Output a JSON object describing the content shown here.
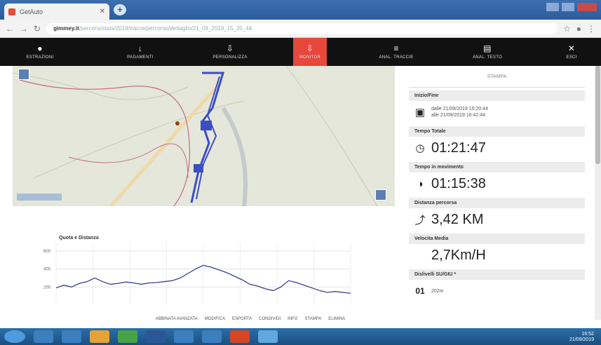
{
  "browser": {
    "tab_title": "GetAuto",
    "url_host": "gimmey.it",
    "url_rest": "/percorsi/stats/2019/tracce/percorso/dettaglio/21_09_2019_15_20_44"
  },
  "toolbar": {
    "items": [
      {
        "label": "ESTRAZIONI",
        "icon": "●"
      },
      {
        "label": "PAGAMENTI",
        "icon": "↓"
      },
      {
        "label": "PERSONALIZZA",
        "icon": "⇩"
      },
      {
        "label": "MONITOR",
        "icon": "⇩"
      },
      {
        "label": "ANAL. TRACCIE",
        "icon": "≡"
      },
      {
        "label": "ANAL. TESTO",
        "icon": "▤"
      },
      {
        "label": "ESCI",
        "icon": "✕"
      }
    ],
    "active_index": 3,
    "accent": "#e8473c"
  },
  "chart": {
    "title": "Quota e Distanza"
  },
  "chart_data": {
    "type": "line",
    "title": "Quota e Distanza",
    "ylim": [
      0,
      700
    ],
    "yticks": [
      "600",
      "400",
      "200"
    ],
    "series": [
      {
        "values": [
          190,
          220,
          200,
          240,
          260,
          300,
          260,
          230,
          240,
          255,
          245,
          230,
          245,
          250,
          260,
          270,
          300,
          350,
          400,
          440,
          420,
          390,
          360,
          320,
          280,
          230,
          210,
          180,
          160,
          200,
          270,
          250,
          220,
          190,
          160,
          140,
          150,
          140,
          130
        ]
      }
    ],
    "grid": true
  },
  "legend": [
    "ABBINATA AVANZATA",
    "MODIFICA",
    "ESPORTA",
    "CONDIVIDI",
    "INFO",
    "STAMPA",
    "ELIMINA"
  ],
  "panel": {
    "banner": "STAMPA",
    "inizio_fine_label": "Inizio/Fine",
    "dalle": "dalle 21/09/2019 15:20:44",
    "alle": "alle 21/09/2019 16:42:44",
    "tempo_totale_label": "Tempo Totale",
    "tempo_totale": "01:21:47",
    "tempo_movimento_label": "Tempo in movimento",
    "tempo_movimento": "01:15:38",
    "distanza_label": "Distanza percorsa",
    "distanza": "3,42 KM",
    "velocita_label": "Velocita Media",
    "velocita": "2,7Km/H",
    "dislivelli_label": "Dislivelli SU/GIU *",
    "dislivelli_icon": "01",
    "dislivelli_value": "202m"
  },
  "taskbar": {
    "time": "16:52",
    "date": "21/09/2019"
  }
}
